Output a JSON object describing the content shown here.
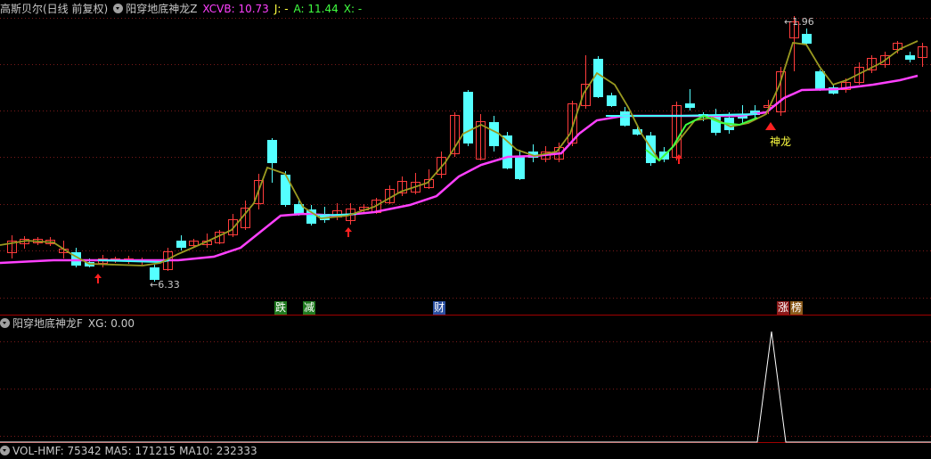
{
  "main_header": {
    "title": "高斯贝尔(日线 前复权)",
    "indicator": "阳穿地底神龙Z",
    "xcvb": "XCVB: 10.73",
    "j": "J: -",
    "a": "A: 11.44",
    "x": "X: -",
    "colors": {
      "title": "#c8c8c8",
      "xcvb": "#ff40ff",
      "j": "#ffff40",
      "a": "#40ff40",
      "x": "#40ff40"
    }
  },
  "sub_header": {
    "indicator": "阳穿地底神龙F",
    "xg": "XG: 0.00"
  },
  "vol_header": {
    "text": "VOL-HMF: 75342  MA5: 171215  MA10: 232333"
  },
  "annotations": {
    "high": "←1.96",
    "low": "←6.33",
    "signal": "神龙"
  },
  "tags": [
    {
      "text": "跌",
      "bg": "#1f7a1f",
      "color": "#ffffff"
    },
    {
      "text": "减",
      "bg": "#1f7a1f",
      "color": "#ffffff"
    },
    {
      "text": "财",
      "bg": "#2a4fa0",
      "color": "#ffffff"
    },
    {
      "text": "涨",
      "bg": "#8b1a1a",
      "color": "#ffffff"
    },
    {
      "text": "榜",
      "bg": "#8b5a1a",
      "color": "#ffffff"
    }
  ],
  "colors": {
    "up": "#ff3c3c",
    "down": "#54ffff",
    "ma_slow": "#ff40ff",
    "ma_fast": "#9a9a20",
    "ma_fast_alt": "#40ff40",
    "ma_mid": "#40ffff",
    "grid": "#7a1a1a",
    "divider": "#a00000",
    "arrow": "#ff2020",
    "xg_line": "#ffffff"
  }
}
